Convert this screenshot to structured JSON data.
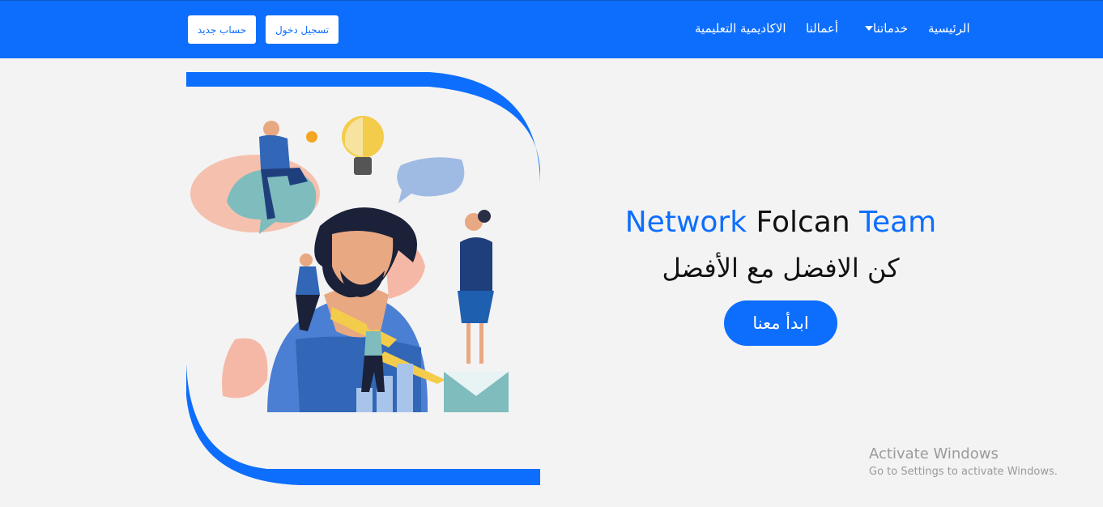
{
  "navbar": {
    "signup_label": "حساب جديد",
    "login_label": "تسجيل دخول",
    "links": {
      "home": "الرئيسية",
      "services": "خدماتنا",
      "works": "أعمالنا",
      "academy": "الاكاديمية التعليمية"
    }
  },
  "hero": {
    "title_part1": "Network",
    "title_part2": "Folcan",
    "title_part3": "Team",
    "subtitle": "كن الافضل مع الأفضل",
    "cta_label": "ابدأ معنا"
  },
  "watermark": {
    "line1": "Activate Windows",
    "line2": "Go to Settings to activate Windows."
  },
  "colors": {
    "primary": "#0d6efd",
    "background": "#f3f3f3",
    "text": "#111111"
  },
  "icons": {
    "services_dropdown": "caret-down-icon"
  }
}
